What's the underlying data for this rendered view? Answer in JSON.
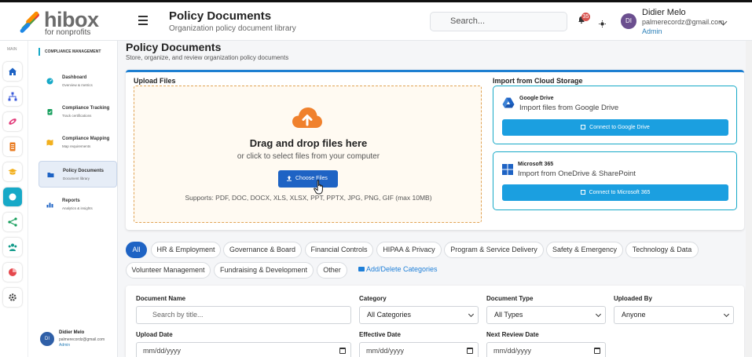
{
  "header": {
    "logo_brand": "hibox",
    "logo_tag": "for nonprofits",
    "title": "Policy Documents",
    "subtitle": "Organization policy document library",
    "search_placeholder": "Search...",
    "notification_count": "35",
    "user": {
      "initials": "DI",
      "name": "Didier Melo",
      "email": "palmerecordz@gmail.com",
      "role": "Admin"
    }
  },
  "rail": {
    "label": "MAIN",
    "icons": [
      "home-icon",
      "org-chart-icon",
      "link-icon",
      "document-icon",
      "graduation-cap-icon",
      "circle-icon",
      "share-icon",
      "users-icon",
      "pie-chart-icon",
      "gear-icon"
    ],
    "active_index": 5
  },
  "submenu": {
    "heading": "COMPLIANCE MANAGEMENT",
    "items": [
      {
        "title": "Dashboard",
        "sub": "Overview & metrics"
      },
      {
        "title": "Compliance Tracking",
        "sub": "Track certifications"
      },
      {
        "title": "Compliance Mapping",
        "sub": "Map requirements"
      },
      {
        "title": "Policy Documents",
        "sub": "Document library"
      },
      {
        "title": "Reports",
        "sub": "Analytics & insights"
      }
    ],
    "active_index": 3,
    "user": {
      "initials": "DI",
      "name": "Didier Melo",
      "email": "palmerecordz@gmail.com",
      "role": "Admin"
    }
  },
  "main": {
    "title": "Policy Documents",
    "subtitle": "Store, organize, and review organization policy documents",
    "upload": {
      "label": "Upload Files",
      "drop_title": "Drag and drop files here",
      "drop_sub": "or click to select files from your computer",
      "choose_label": "Choose Files",
      "supports": "Supports: PDF, DOC, DOCX, XLS, XLSX, PPT, PPTX, JPG, PNG, GIF (max 10MB)"
    },
    "cloud": {
      "label": "Import from Cloud Storage",
      "google": {
        "name": "Google Drive",
        "desc": "Import files from Google Drive",
        "button": "Connect to Google Drive"
      },
      "microsoft": {
        "name": "Microsoft 365",
        "desc": "Import from OneDrive & SharePoint",
        "button": "Connect to Microsoft 365"
      }
    },
    "categories": [
      "All",
      "HR & Employment",
      "Governance & Board",
      "Financial Controls",
      "HIPAA & Privacy",
      "Program & Service Delivery",
      "Safety & Emergency",
      "Technology & Data",
      "Volunteer Management",
      "Fundraising & Development",
      "Other"
    ],
    "active_category": "All",
    "manage_link": "Add/Delete Categories",
    "filters": {
      "document_name_label": "Document Name",
      "document_name_placeholder": "Search by title...",
      "category_label": "Category",
      "category_value": "All Categories",
      "type_label": "Document Type",
      "type_value": "All Types",
      "uploaded_by_label": "Uploaded By",
      "uploaded_by_value": "Anyone",
      "upload_date_label": "Upload Date",
      "effective_date_label": "Effective Date",
      "next_review_label": "Next Review Date",
      "date_placeholder": "mm/dd/yyyy"
    }
  },
  "colors": {
    "accent": "#17a9c7",
    "primary": "#1e63c4",
    "upload_orange": "#f0812d",
    "cloud_button": "#1b9fe0"
  }
}
